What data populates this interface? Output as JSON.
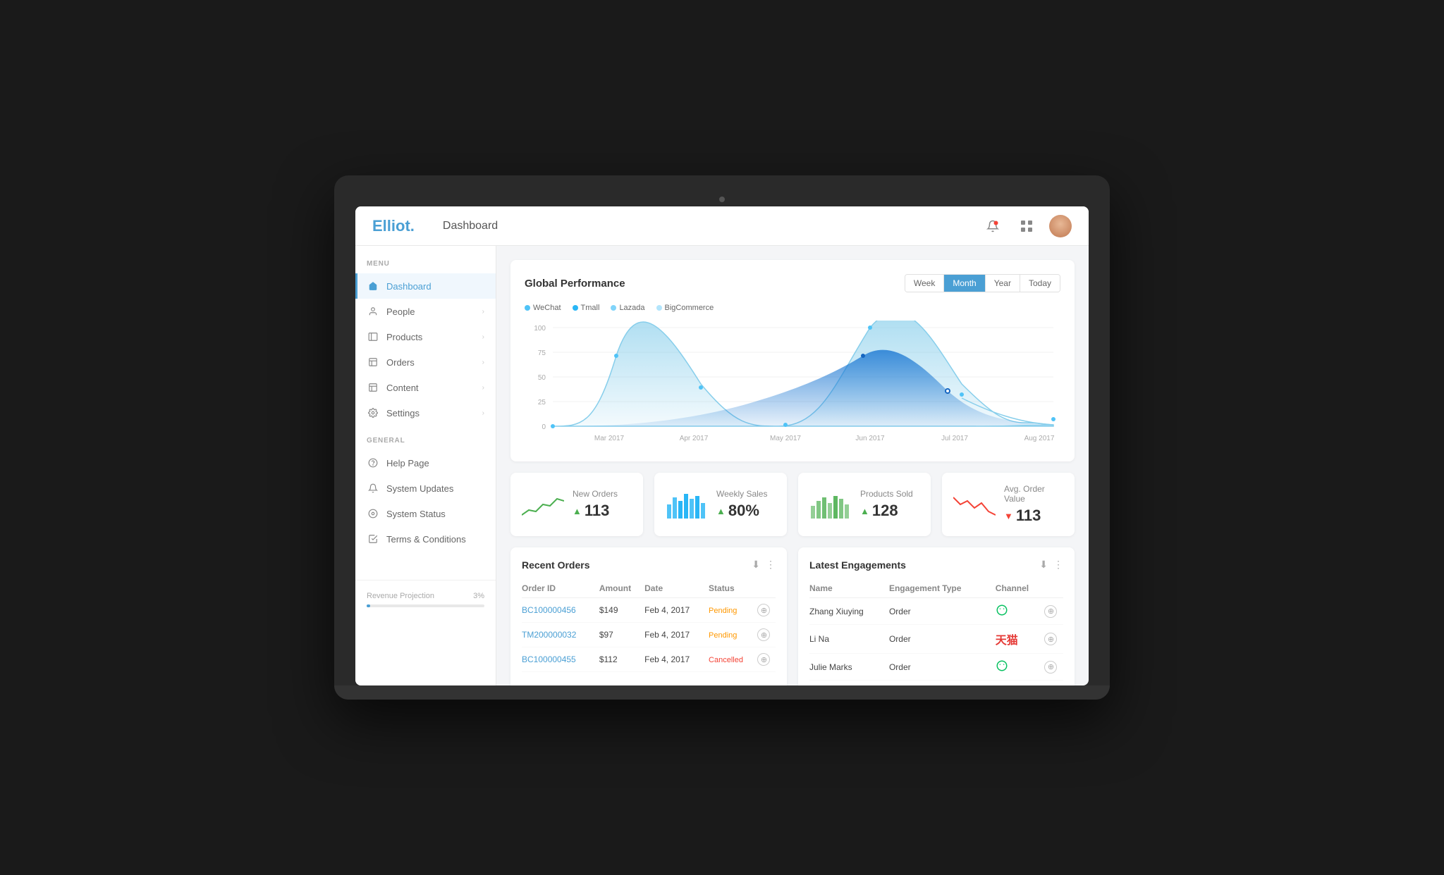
{
  "app": {
    "logo": "Elliot",
    "logo_dot": ".",
    "page_title": "Dashboard"
  },
  "topbar": {
    "bell_icon": "🔔",
    "grid_icon": "⊞"
  },
  "sidebar": {
    "menu_label": "MENU",
    "general_label": "GENERAL",
    "items": [
      {
        "id": "dashboard",
        "label": "Dashboard",
        "icon": "🏠",
        "active": true
      },
      {
        "id": "people",
        "label": "People",
        "icon": "●",
        "has_arrow": true
      },
      {
        "id": "products",
        "label": "Products",
        "icon": "▣",
        "has_arrow": true
      },
      {
        "id": "orders",
        "label": "Orders",
        "icon": "▤",
        "has_arrow": true
      },
      {
        "id": "content",
        "label": "Content",
        "icon": "▤",
        "has_arrow": true
      },
      {
        "id": "settings",
        "label": "Settings",
        "icon": "⚙",
        "has_arrow": true
      }
    ],
    "general_items": [
      {
        "id": "help",
        "label": "Help Page",
        "icon": "?"
      },
      {
        "id": "updates",
        "label": "System Updates",
        "icon": "🔔"
      },
      {
        "id": "status",
        "label": "System Status",
        "icon": "◎"
      },
      {
        "id": "terms",
        "label": "Terms & Conditions",
        "icon": "☑"
      }
    ],
    "revenue": {
      "label": "Revenue Projection",
      "percent": "3%"
    }
  },
  "chart": {
    "title": "Global Performance",
    "period_buttons": [
      "Week",
      "Month",
      "Year",
      "Today"
    ],
    "active_period": "Month",
    "legend": [
      {
        "label": "WeChat",
        "color": "#4fc3f7"
      },
      {
        "label": "Tmall",
        "color": "#29b6f6"
      },
      {
        "label": "Lazada",
        "color": "#81d4fa"
      },
      {
        "label": "BigCommerce",
        "color": "#b3e5fc"
      }
    ],
    "x_labels": [
      "Mar 2017",
      "Apr 2017",
      "May 2017",
      "Jun 2017",
      "Jul 2017",
      "Aug 2017"
    ],
    "y_labels": [
      "100",
      "75",
      "50",
      "25",
      "0"
    ]
  },
  "stats": [
    {
      "label": "New Orders",
      "value": "113",
      "trend": "up",
      "trend_symbol": "▲",
      "chart_color": "#4caf50"
    },
    {
      "label": "Weekly Sales",
      "value": "80%",
      "trend": "up",
      "trend_symbol": "▲",
      "chart_color": "#4caf50"
    },
    {
      "label": "Products Sold",
      "value": "128",
      "trend": "up",
      "trend_symbol": "▲",
      "chart_color": "#4caf50"
    },
    {
      "label": "Avg. Order Value",
      "value": "113",
      "trend": "down",
      "trend_symbol": "▼",
      "chart_color": "#f44336"
    }
  ],
  "orders": {
    "title": "Recent Orders",
    "columns": [
      "Order ID",
      "Amount",
      "Date",
      "Status"
    ],
    "rows": [
      {
        "id": "BC100000456",
        "amount": "$149",
        "date": "Feb 4, 2017",
        "status": "Pending",
        "status_class": "pending"
      },
      {
        "id": "TM200000032",
        "amount": "$97",
        "date": "Feb 4, 2017",
        "status": "Pending",
        "status_class": "pending"
      },
      {
        "id": "BC100000455",
        "amount": "$112",
        "date": "Feb 4, 2017",
        "status": "Cancelled",
        "status_class": "cancelled"
      }
    ]
  },
  "engagements": {
    "title": "Latest Engagements",
    "columns": [
      "Name",
      "Engagement Type",
      "Channel"
    ],
    "rows": [
      {
        "name": "Zhang Xiuying",
        "type": "Order",
        "channel": "wechat"
      },
      {
        "name": "Li Na",
        "type": "Order",
        "channel": "tmall"
      },
      {
        "name": "Julie Marks",
        "type": "Order",
        "channel": "wechat"
      }
    ]
  }
}
